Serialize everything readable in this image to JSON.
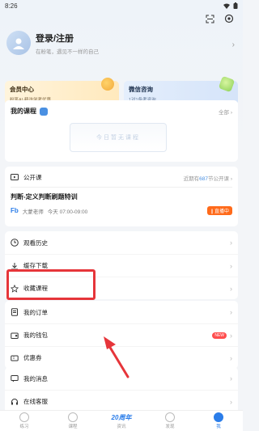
{
  "status": {
    "time": "8:26"
  },
  "profile": {
    "title": "登录/注册",
    "subtitle": "在粉笔，遇见不一样的自己"
  },
  "cards": [
    {
      "title": "会员中心",
      "subtitle": "粉笔AI·精选学考优惠"
    },
    {
      "title": "微信咨询",
      "subtitle": "1对1备考咨询"
    }
  ],
  "courses": {
    "title": "我的课程",
    "all": "全部",
    "empty_text": "今日暂无课程"
  },
  "public_class": {
    "label": "公开课",
    "count_prefix": "近期有",
    "count": "687",
    "count_suffix": "节公开课",
    "course_name": "判断-定义判断刷题特训",
    "teacher": "大蒙老师",
    "time": "今天 07:00-09:00",
    "live_label": "直播中"
  },
  "menu1": [
    {
      "label": "观看历史"
    },
    {
      "label": "缓存下载"
    },
    {
      "label": "收藏课程"
    }
  ],
  "menu2": [
    {
      "label": "我的订单"
    },
    {
      "label": "我的钱包",
      "badge": "NEW"
    },
    {
      "label": "优惠券"
    }
  ],
  "menu3": [
    {
      "label": "我的消息"
    },
    {
      "label": "在线客服"
    }
  ],
  "tabs": [
    {
      "label": "练习"
    },
    {
      "label": "课程"
    },
    {
      "label": "资讯"
    },
    {
      "label": "发现"
    },
    {
      "label": "我"
    }
  ],
  "center_tab_logo": "20周年",
  "colors": {
    "accent": "#2b7de9",
    "highlight": "#e6353a",
    "live": "#ff6a1a"
  }
}
